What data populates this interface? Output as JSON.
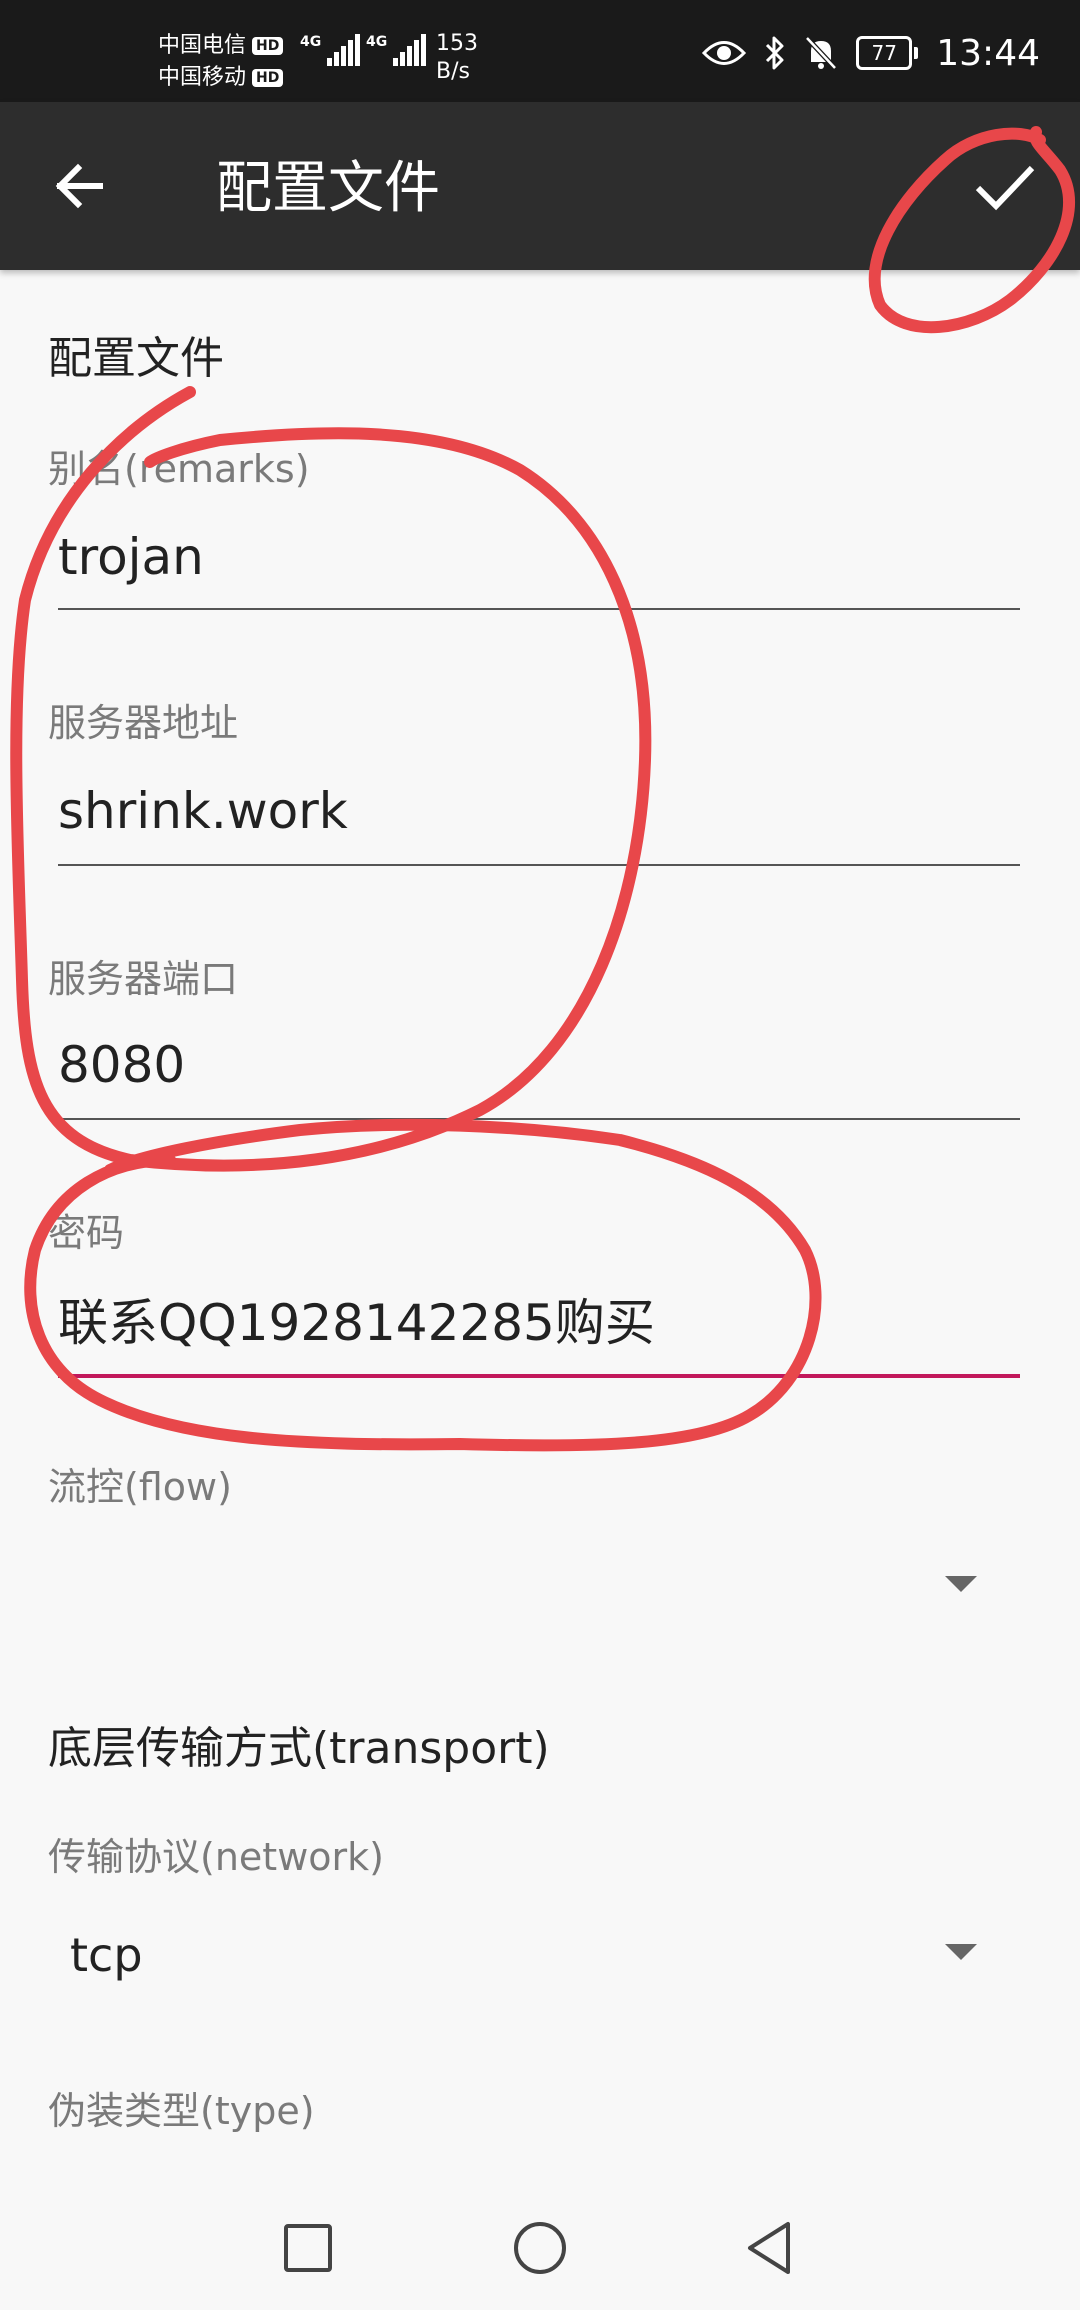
{
  "status_bar": {
    "carrier_1": "中国电信",
    "carrier_2": "中国移动",
    "hd_badge": "HD",
    "network_type": "4G",
    "speed_value": "153",
    "speed_unit": "B/s",
    "battery_level": "77",
    "time": "13:44",
    "icons": [
      "eye-icon",
      "bluetooth-icon",
      "bell-muted-icon",
      "battery-icon"
    ]
  },
  "app_bar": {
    "title": "配置文件",
    "back_icon": "arrow-left-icon",
    "save_icon": "check-icon",
    "bg_color": "#2d2d2d"
  },
  "form": {
    "section_profile": "配置文件",
    "remarks": {
      "label": "别名(remarks)",
      "value": "trojan"
    },
    "address": {
      "label": "服务器地址",
      "value": "shrink.work"
    },
    "port": {
      "label": "服务器端口",
      "value": "8080"
    },
    "password": {
      "label": "密码",
      "value": "联系QQ1928142285购买",
      "accent_color": "#c2185b"
    },
    "flow": {
      "label": "流控(flow)",
      "value": ""
    },
    "section_transport": "底层传输方式(transport)",
    "network": {
      "label": "传输协议(network)",
      "value": "tcp"
    },
    "header_type": {
      "label": "伪装类型(type)"
    }
  },
  "nav_bar": {
    "icons": [
      "recents-square-icon",
      "home-circle-icon",
      "back-triangle-icon"
    ]
  },
  "annotation_color": "#e8474a"
}
